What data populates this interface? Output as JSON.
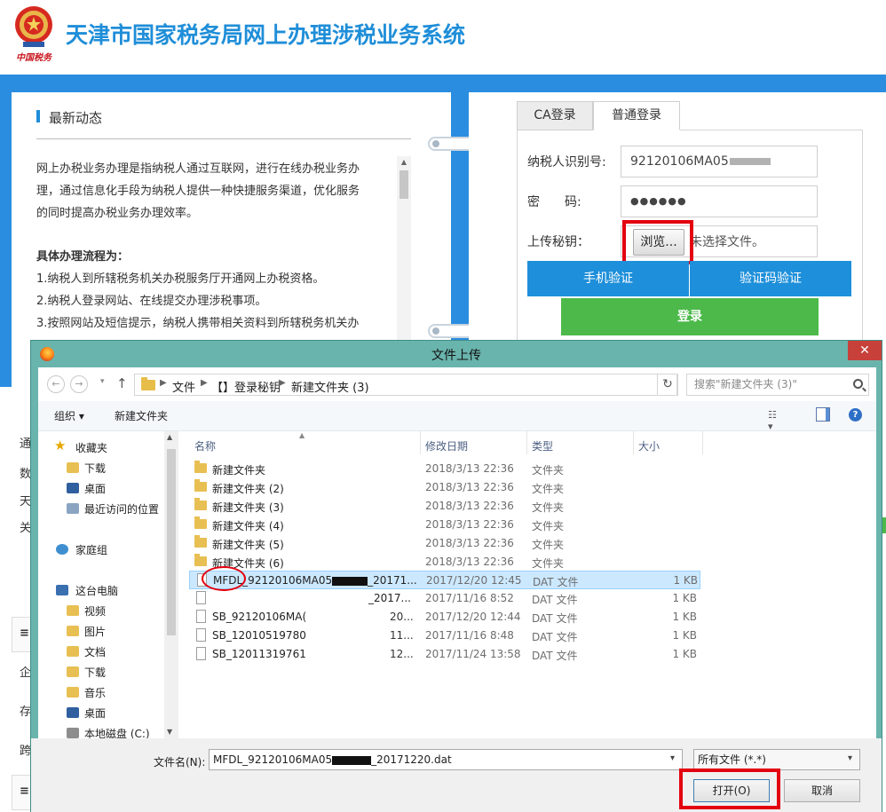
{
  "header": {
    "title": "天津市国家税务局网上办理涉税业务系统",
    "emblem_caption": "中国税务"
  },
  "news": {
    "title": "最新动态",
    "paragraph": [
      "网上办税业务办理是指纳税人通过互联网，进行在线办税业务办",
      "理，通过信息化手段为纳税人提供一种快捷服务渠道，优化服务",
      "的同时提高办税业务办理效率。"
    ],
    "steps_title": "具体办理流程为：",
    "steps": [
      "1.纳税人到所辖税务机关办税服务厅开通网上办税资格。",
      "2.纳税人登录网站、在线提交办理涉税事项。",
      "3.按照网站及短信提示，纳税人携带相关资料到所辖税务机关办"
    ]
  },
  "login": {
    "tabs": [
      "CA登录",
      "普通登录"
    ],
    "taxpayer_id_label": "纳税人识别号:",
    "taxpayer_id_value": "92120106MA05",
    "password_label": "密　　码:",
    "password_value": "●●●●●●",
    "upload_label": "上传秘钥：",
    "browse_label": "浏览...",
    "no_file_text": "未选择文件。",
    "phone_verify": "手机验证",
    "code_verify": "验证码验证",
    "login_button": "登录"
  },
  "background_stubs": [
    "通",
    "数",
    "天",
    "关",
    "≡",
    "企",
    "存",
    "跨",
    "≡"
  ],
  "dialog": {
    "title": "文件上传",
    "close": "✕",
    "breadcrumbs": [
      "文件",
      "【】登录秘钥",
      "新建文件夹 (3)"
    ],
    "search_placeholder": "搜索\"新建文件夹 (3)\"",
    "commands": {
      "organize": "组织 ▾",
      "new_folder": "新建文件夹"
    },
    "nav_items": [
      {
        "label": "收藏夹",
        "icon": "star-icon"
      },
      {
        "label": "下载",
        "icon": "download-folder-icon"
      },
      {
        "label": "桌面",
        "icon": "desktop-icon"
      },
      {
        "label": "最近访问的位置",
        "icon": "recent-places-icon"
      },
      {
        "label": "家庭组",
        "icon": "homegroup-icon"
      },
      {
        "label": "这台电脑",
        "icon": "computer-icon"
      },
      {
        "label": "视频",
        "icon": "videos-folder-icon"
      },
      {
        "label": "图片",
        "icon": "pictures-folder-icon"
      },
      {
        "label": "文档",
        "icon": "documents-folder-icon"
      },
      {
        "label": "下载",
        "icon": "download-folder-icon"
      },
      {
        "label": "音乐",
        "icon": "music-folder-icon"
      },
      {
        "label": "桌面",
        "icon": "desktop-icon"
      },
      {
        "label": "本地磁盘 (C:)",
        "icon": "drive-icon"
      }
    ],
    "columns": [
      "名称",
      "修改日期",
      "类型",
      "大小"
    ],
    "files": [
      {
        "name": "新建文件夹",
        "date": "2018/3/13 22:36",
        "type": "文件夹",
        "size": "",
        "kind": "folder"
      },
      {
        "name": "新建文件夹 (2)",
        "date": "2018/3/13 22:36",
        "type": "文件夹",
        "size": "",
        "kind": "folder"
      },
      {
        "name": "新建文件夹 (3)",
        "date": "2018/3/13 22:36",
        "type": "文件夹",
        "size": "",
        "kind": "folder"
      },
      {
        "name": "新建文件夹 (4)",
        "date": "2018/3/13 22:36",
        "type": "文件夹",
        "size": "",
        "kind": "folder"
      },
      {
        "name": "新建文件夹 (5)",
        "date": "2018/3/13 22:36",
        "type": "文件夹",
        "size": "",
        "kind": "folder"
      },
      {
        "name": "新建文件夹 (6)",
        "date": "2018/3/13 22:36",
        "type": "文件夹",
        "size": "",
        "kind": "folder"
      },
      {
        "name": "MFDL_92120106MA05",
        "name_tail": "_20171...",
        "date": "2017/12/20 12:45",
        "type": "DAT 文件",
        "size": "1 KB",
        "kind": "file",
        "selected": true
      },
      {
        "name": "",
        "name_tail": "_2017...",
        "date": "2017/11/16 8:52",
        "type": "DAT 文件",
        "size": "1 KB",
        "kind": "file"
      },
      {
        "name": "SB_92120106MA(",
        "name_tail": "20...",
        "date": "2017/12/20 12:44",
        "type": "DAT 文件",
        "size": "1 KB",
        "kind": "file"
      },
      {
        "name": "SB_12010519780",
        "name_tail": "11...",
        "date": "2017/11/16 8:48",
        "type": "DAT 文件",
        "size": "1 KB",
        "kind": "file"
      },
      {
        "name": "SB_12011319761",
        "name_tail": "12...",
        "date": "2017/11/24 13:58",
        "type": "DAT 文件",
        "size": "1 KB",
        "kind": "file"
      }
    ],
    "filename_label": "文件名(N):",
    "filename_head": "MFDL_92120106MA05",
    "filename_tail": "_20171220.dat",
    "filetype": "所有文件 (*.*)",
    "open_button": "打开(O)",
    "cancel_button": "取消"
  },
  "colors": {
    "brand_blue": "#1f8ed8",
    "band_blue": "#2a8de0",
    "login_green": "#4cb94a",
    "highlight_red": "#e3000f",
    "dialog_frame": "#69b4ad"
  }
}
